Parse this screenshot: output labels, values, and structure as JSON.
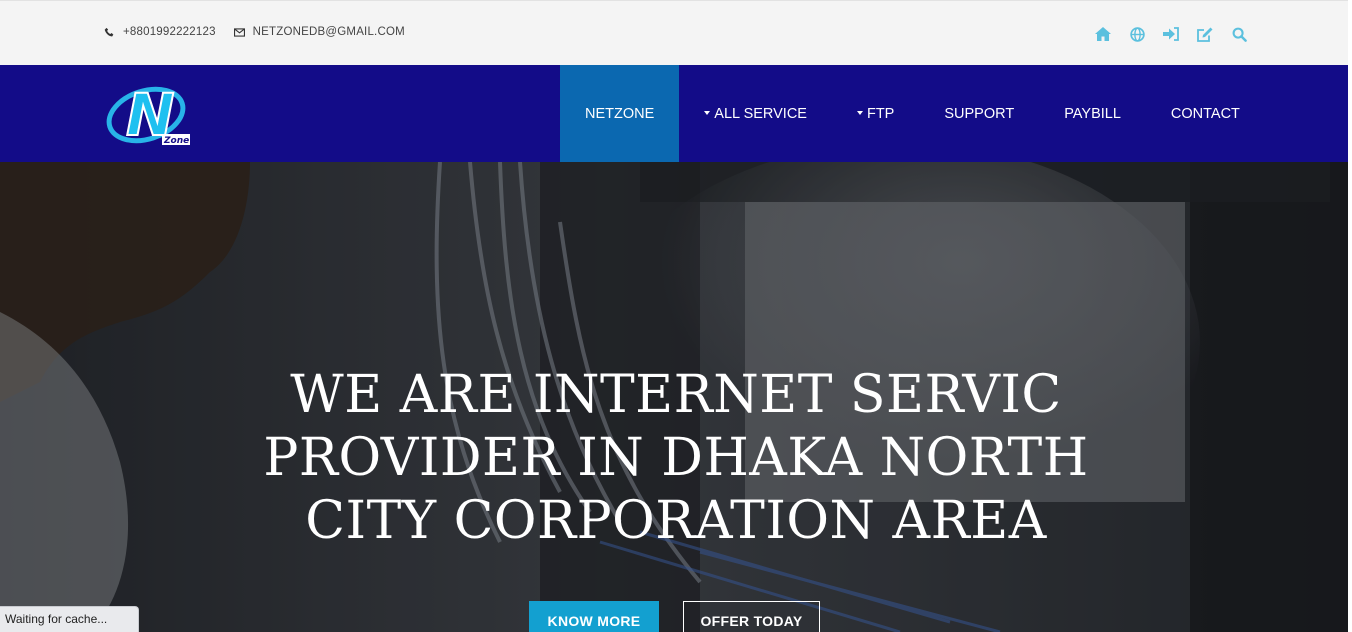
{
  "topbar": {
    "phone": "+8801992222123",
    "email": "NETZONEDB@GMAIL.COM",
    "icons": [
      "home-icon",
      "globe-icon",
      "sign-in-icon",
      "edit-icon",
      "search-icon"
    ],
    "icon_color": "#5bc0de"
  },
  "logo": {
    "letter": "N",
    "word": "Zone"
  },
  "nav": {
    "items": [
      {
        "label": "NETZONE",
        "active": true,
        "dropdown": false
      },
      {
        "label": "ALL SERVICE",
        "active": false,
        "dropdown": true
      },
      {
        "label": "FTP",
        "active": false,
        "dropdown": true
      },
      {
        "label": "SUPPORT",
        "active": false,
        "dropdown": false
      },
      {
        "label": "PAYBILL",
        "active": false,
        "dropdown": false
      },
      {
        "label": "CONTACT",
        "active": false,
        "dropdown": false
      }
    ],
    "bg_color": "#130c88",
    "active_color": "#0b68b0"
  },
  "hero": {
    "lines": [
      "WE ARE INTERNET SERVIC",
      "PROVIDER IN DHAKA NORTH",
      "CITY CORPORATION AREA"
    ],
    "know_more": "KNOW MORE",
    "offer_today": "OFFER TODAY"
  },
  "status_bar": "Waiting for cache..."
}
